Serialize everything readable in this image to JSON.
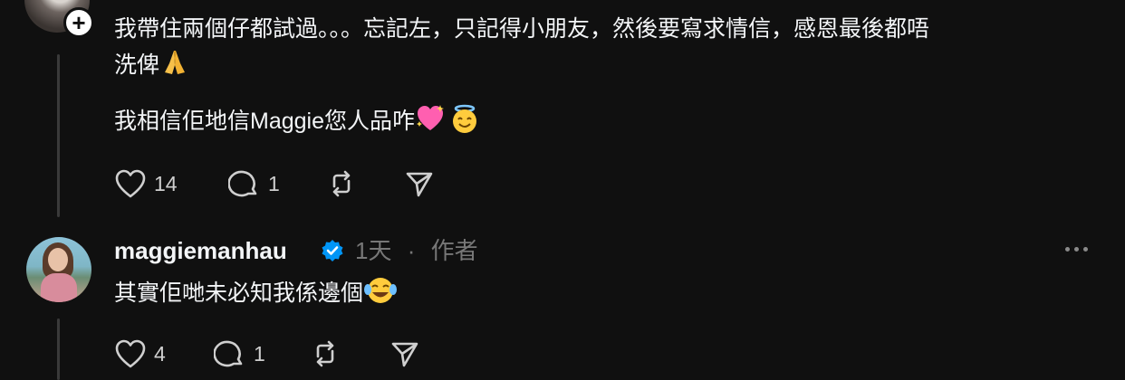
{
  "comment1": {
    "line1": "我帶住兩個仔都試過。。。忘記左，只記得小朋友，然後要寫求情信，感恩最後都唔",
    "line2": "洗俾",
    "line3": "我相信佢地信Maggie您人品咋",
    "likes": "14",
    "replies": "1",
    "icons": [
      "folded-hands-emoji",
      "sparkling-heart-emoji",
      "smiling-face-with-halo-emoji"
    ]
  },
  "comment2": {
    "username": "maggiemanhau",
    "time": "1天",
    "separator": "·",
    "role": "作者",
    "text": "其實佢哋未必知我係邊個",
    "likes": "4",
    "replies": "1",
    "icons": [
      "face-with-tears-of-joy-emoji"
    ]
  },
  "colors": {
    "background": "#101010",
    "text": "#f3f5f7",
    "muted": "#777777",
    "verified": "#0095f6"
  }
}
